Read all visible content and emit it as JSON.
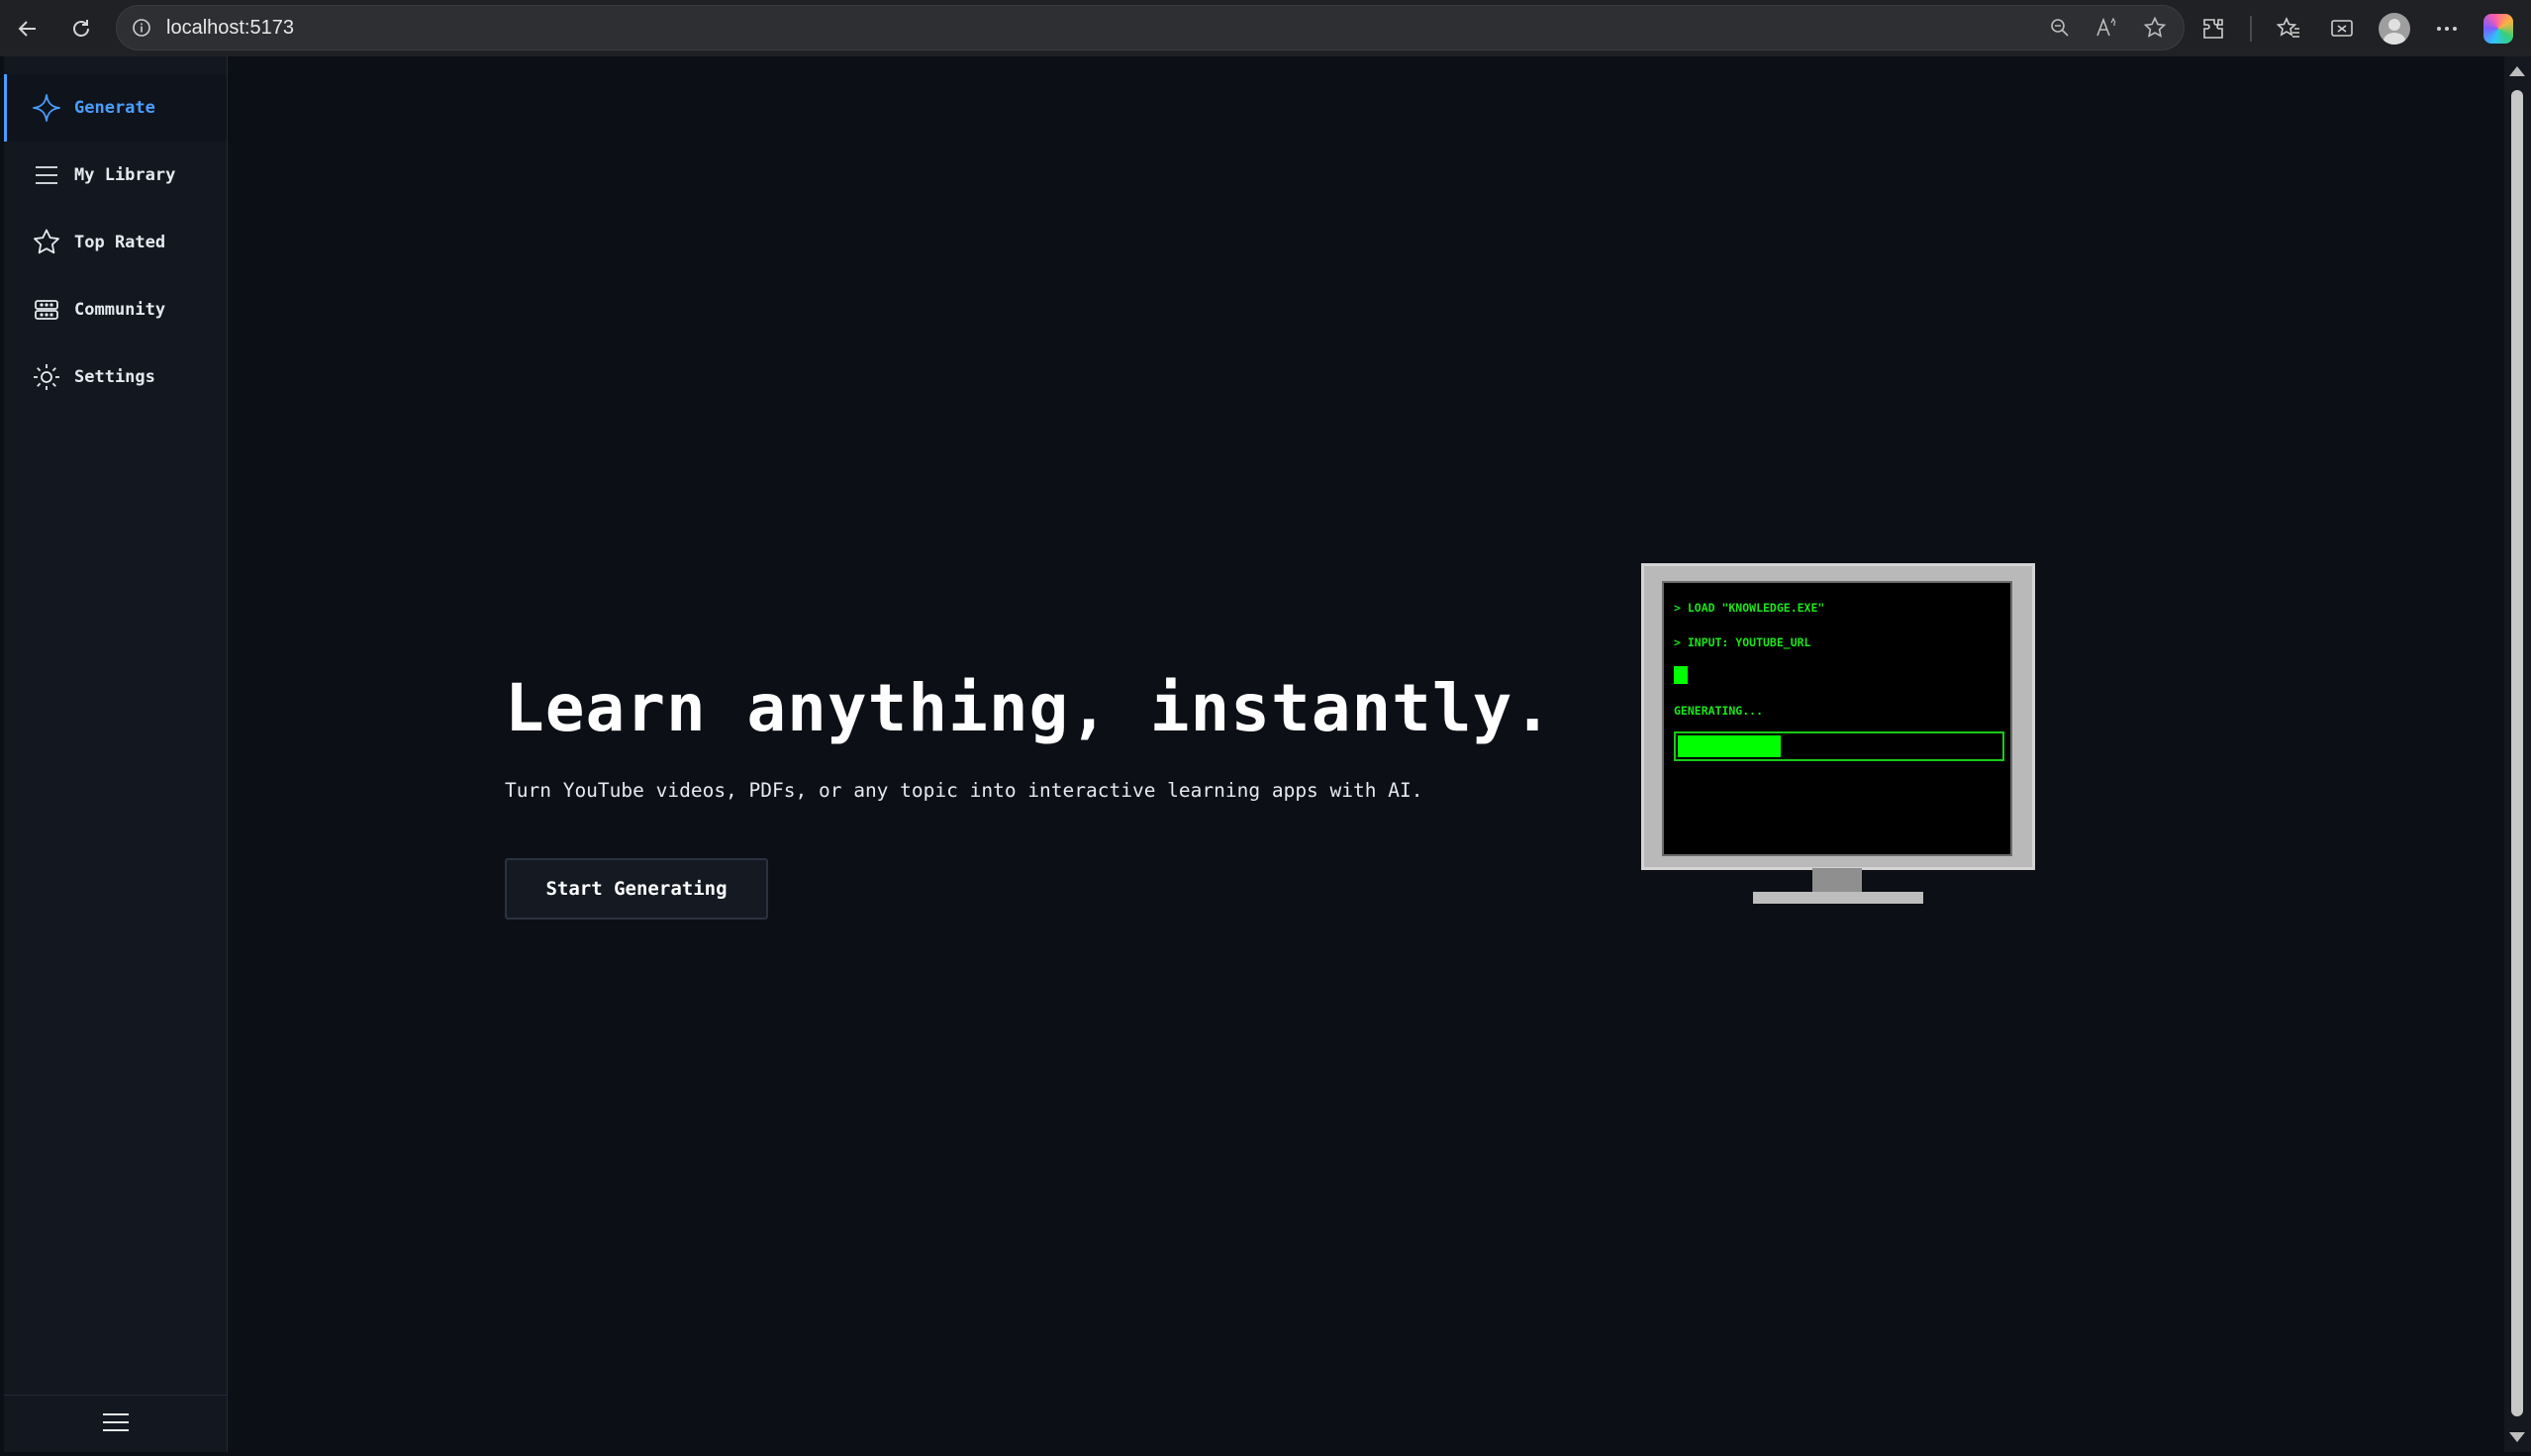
{
  "browser": {
    "url": "localhost:5173"
  },
  "sidebar": {
    "items": [
      {
        "label": "Generate",
        "icon": "sparkle-icon",
        "active": true
      },
      {
        "label": "My Library",
        "icon": "list-icon",
        "active": false
      },
      {
        "label": "Top Rated",
        "icon": "star-icon",
        "active": false
      },
      {
        "label": "Community",
        "icon": "community-icon",
        "active": false
      },
      {
        "label": "Settings",
        "icon": "sun-icon",
        "active": false
      }
    ],
    "footer_icon": "menu-icon"
  },
  "hero": {
    "title": "Learn anything, instantly.",
    "subtitle": "Turn YouTube videos, PDFs, or any topic into interactive learning apps with AI.",
    "cta_label": "Start Generating"
  },
  "terminal": {
    "line1": "> LOAD \"KNOWLEDGE.EXE\"",
    "line2": "> INPUT: YOUTUBE_URL",
    "line3": "GENERATING...",
    "progress": 0.32
  },
  "colors": {
    "accent": "#4a9eff",
    "terminal_green": "#00ff00",
    "background": "#0c0f15",
    "sidebar": "#131820"
  }
}
